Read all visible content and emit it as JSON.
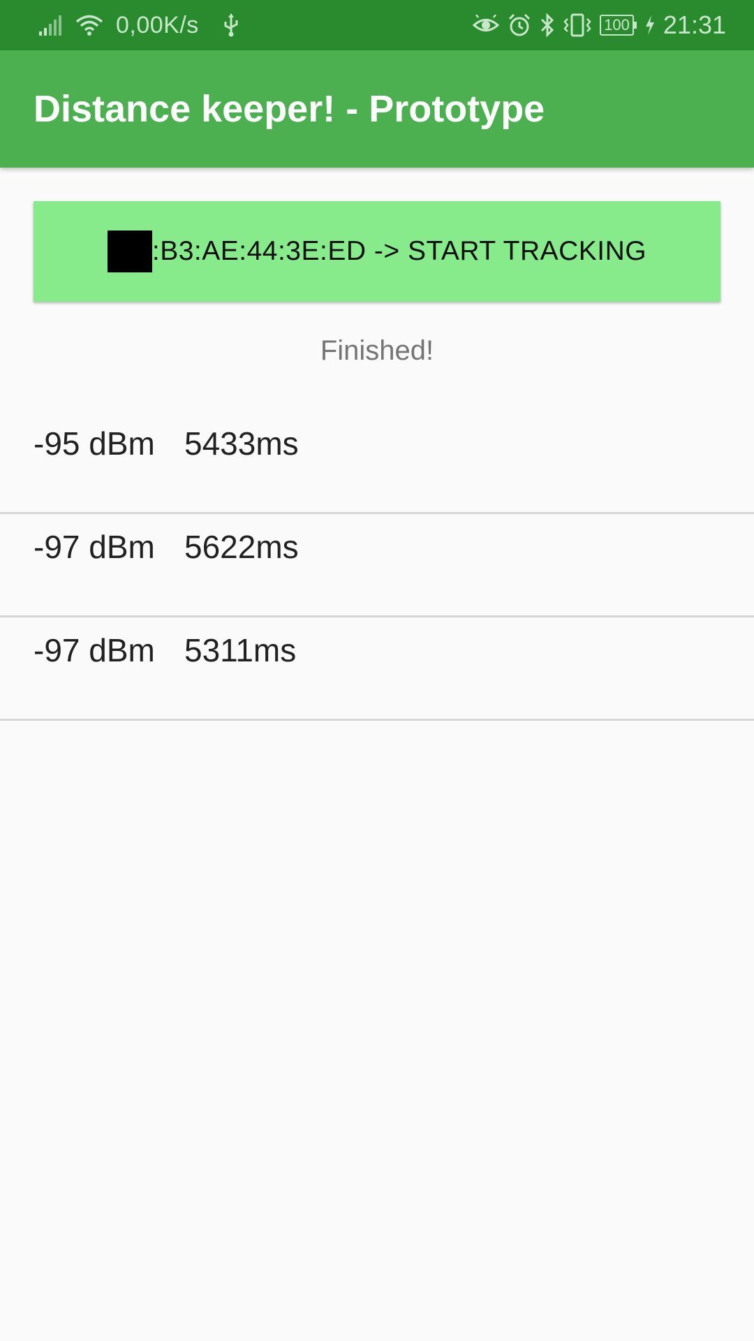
{
  "status_bar": {
    "net_speed": "0,00K/s",
    "battery": "100",
    "time": "21:31",
    "icons": [
      "signal-icon",
      "wifi-icon",
      "usb-icon",
      "eye-icon",
      "alarm-icon",
      "bluetooth-icon",
      "vibrate-icon",
      "battery-icon",
      "charging-icon"
    ]
  },
  "app_bar": {
    "title": "Distance keeper! - Prototype"
  },
  "tracking_button": {
    "label": ":B3:AE:44:3E:ED -> START TRACKING"
  },
  "status_message": "Finished!",
  "readings": [
    {
      "rssi": "-95 dBm",
      "duration": "5433ms"
    },
    {
      "rssi": "-97 dBm",
      "duration": "5622ms"
    },
    {
      "rssi": "-97 dBm",
      "duration": "5311ms"
    }
  ],
  "colors": {
    "status_bar": "#2a8a2e",
    "app_bar": "#4caf50",
    "button": "#88eb8b",
    "background": "#fafafa"
  }
}
